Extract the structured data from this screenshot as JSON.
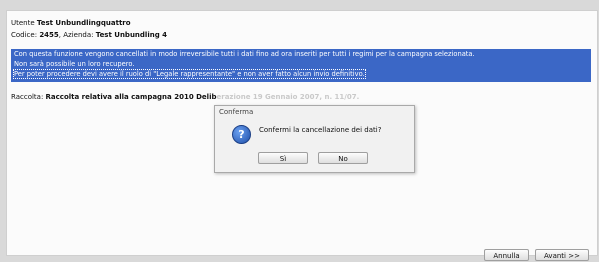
{
  "header": {
    "utente_prefix": "Utente ",
    "utente_name": "Test Unbundlingquattro",
    "codice_prefix": "Codice: ",
    "codice_value": "2455",
    "azienda_prefix": ", Azienda: ",
    "azienda_value": "Test Unbundling 4"
  },
  "notice": {
    "line1": "Con questa funzione vengono cancellati in modo irreversibile tutti i dati fino ad ora inseriti per tutti i regimi per la campagna selezionata.",
    "line2": "Non sarà possibile un loro recupero.",
    "line3": "Per poter procedere devi avere il ruolo di \"Legale rappresentante\" e non aver fatto alcun invio definitivo."
  },
  "raccolta": {
    "prefix": "Raccolta: ",
    "value": "Raccolta relativa alla campagna 2010 Delib",
    "value_hidden": "erazione 19 Gennaio 2007, n. 11/07."
  },
  "dialog": {
    "title": "Conferma",
    "icon": "question-icon",
    "message": "Confermi la cancellazione dei dati?",
    "yes_label": "Sì",
    "no_label": "No"
  },
  "footer": {
    "cancel_label": "Annulla",
    "next_label": "Avanti >>"
  }
}
